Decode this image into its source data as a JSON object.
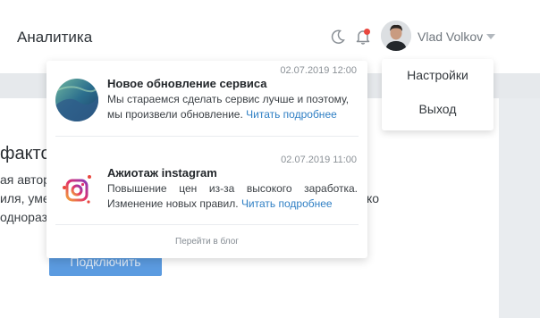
{
  "header": {
    "title": "Аналитика",
    "user_name": "Vlad Volkov",
    "icons": [
      "moon-icon",
      "bell-icon",
      "chevron-down-icon"
    ],
    "bell_badge_color": "#e9473e"
  },
  "user_menu": {
    "items": [
      {
        "label": "Настройки"
      },
      {
        "label": "Выход"
      }
    ]
  },
  "background": {
    "heading": "факто",
    "lines": [
      "ая автор",
      "иля, уме",
      "однораз"
    ],
    "right_fragment": "ко",
    "connect_label": "Подключить",
    "accent_color": "#5b9be0"
  },
  "notifications": {
    "items": [
      {
        "time": "02.07.2019 12:00",
        "title": "Новое обновление сервиса",
        "text": "Мы стараемся сделать сервис лучше и поэтому, мы произвели обновление.",
        "link": "Читать подробнее"
      },
      {
        "time": "02.07.2019 11:00",
        "title": "Ажиотаж instagram",
        "text": "Повышение цен из-за высокого заработка. Изменение новых правил.",
        "link": "Читать подробнее"
      }
    ],
    "footer": "Перейти в блог",
    "link_color": "#2f7fc4"
  }
}
